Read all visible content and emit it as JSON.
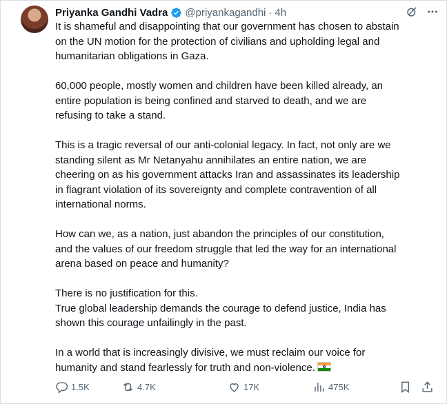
{
  "post": {
    "author_name": "Priyanka Gandhi Vadra",
    "handle": "@priyankagandhi",
    "separator": "·",
    "time": "4h",
    "paragraphs": [
      "It is shameful and disappointing that our government has chosen to abstain\non the UN motion for the protection of civilians and upholding legal and\nhumanitarian obligations in Gaza.",
      "60,000 people, mostly women and children have been killed already, an\nentire population is being confined and starved to death, and we are\nrefusing to take a stand.",
      "This is a tragic reversal of our anti-colonial legacy. In fact, not only are we\nstanding silent as Mr Netanyahu annihilates an entire nation, we are\ncheering on as his government attacks Iran and assassinates its leadership\nin flagrant violation of its sovereignty and complete contravention of all\ninternational norms.",
      "How can we, as a nation, just abandon the principles of our constitution,\nand the values of our freedom struggle that led the way for an international\narena based on peace and humanity?",
      "There is no justification for this.\nTrue global leadership demands the courage to defend justice, India has\nshown this courage unfailingly in the past.",
      "In a world that is increasingly divisive, we must reclaim our voice for\nhumanity and stand fearlessly for truth and non-violence."
    ],
    "closing_emoji": "india-flag-emoji"
  },
  "metrics": {
    "replies": "1.5K",
    "reposts": "4.7K",
    "likes": "17K",
    "views": "475K"
  },
  "icons": {
    "verified": "verified-badge-icon",
    "grok": "grok-icon",
    "more": "more-options-icon",
    "reply": "reply-icon",
    "repost": "repost-icon",
    "like": "like-icon",
    "views": "views-icon",
    "bookmark": "bookmark-icon",
    "share": "share-icon"
  },
  "colors": {
    "text": "#0f1419",
    "secondary": "#536471",
    "verified": "#1d9bf0"
  }
}
